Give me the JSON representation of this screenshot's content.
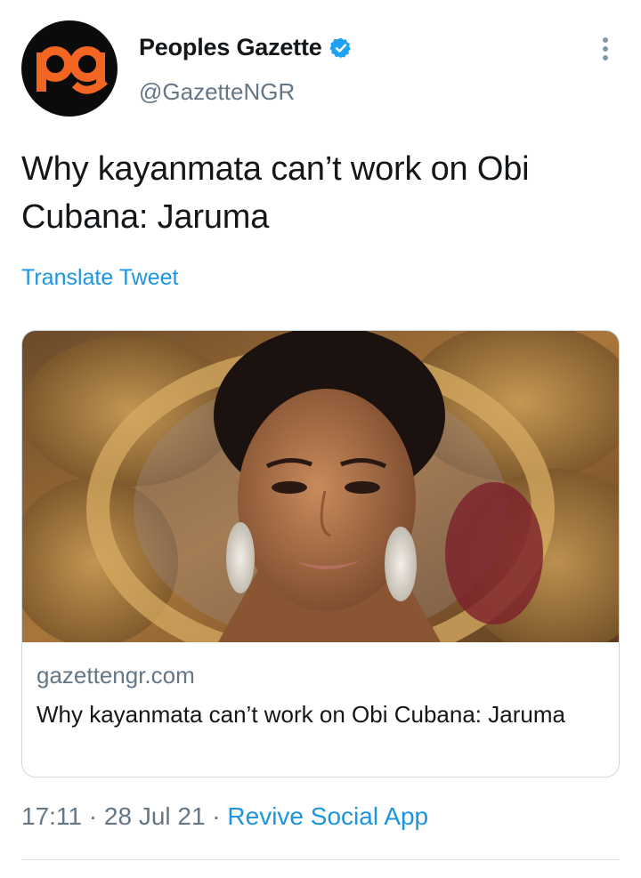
{
  "author": {
    "avatar_text": "pg",
    "name": "Peoples Gazette",
    "handle": "@GazetteNGR",
    "verified": true
  },
  "tweet": {
    "text": "Why kayanmata can’t work on Obi Cubana: Jaruma",
    "translate_label": "Translate Tweet"
  },
  "card": {
    "domain": "gazettengr.com",
    "title": "Why kayanmata can’t work on Obi Cubana: Jaruma"
  },
  "meta": {
    "time": "17:11",
    "separator": " · ",
    "date": "28 Jul 21",
    "app": "Revive Social App"
  },
  "colors": {
    "link": "#1b95e0",
    "secondary_text": "#657786",
    "brand_orange": "#f26522",
    "avatar_bg": "#0b0b0b"
  },
  "icons": {
    "verified": "verified-badge-icon",
    "more": "more-vertical-icon"
  }
}
